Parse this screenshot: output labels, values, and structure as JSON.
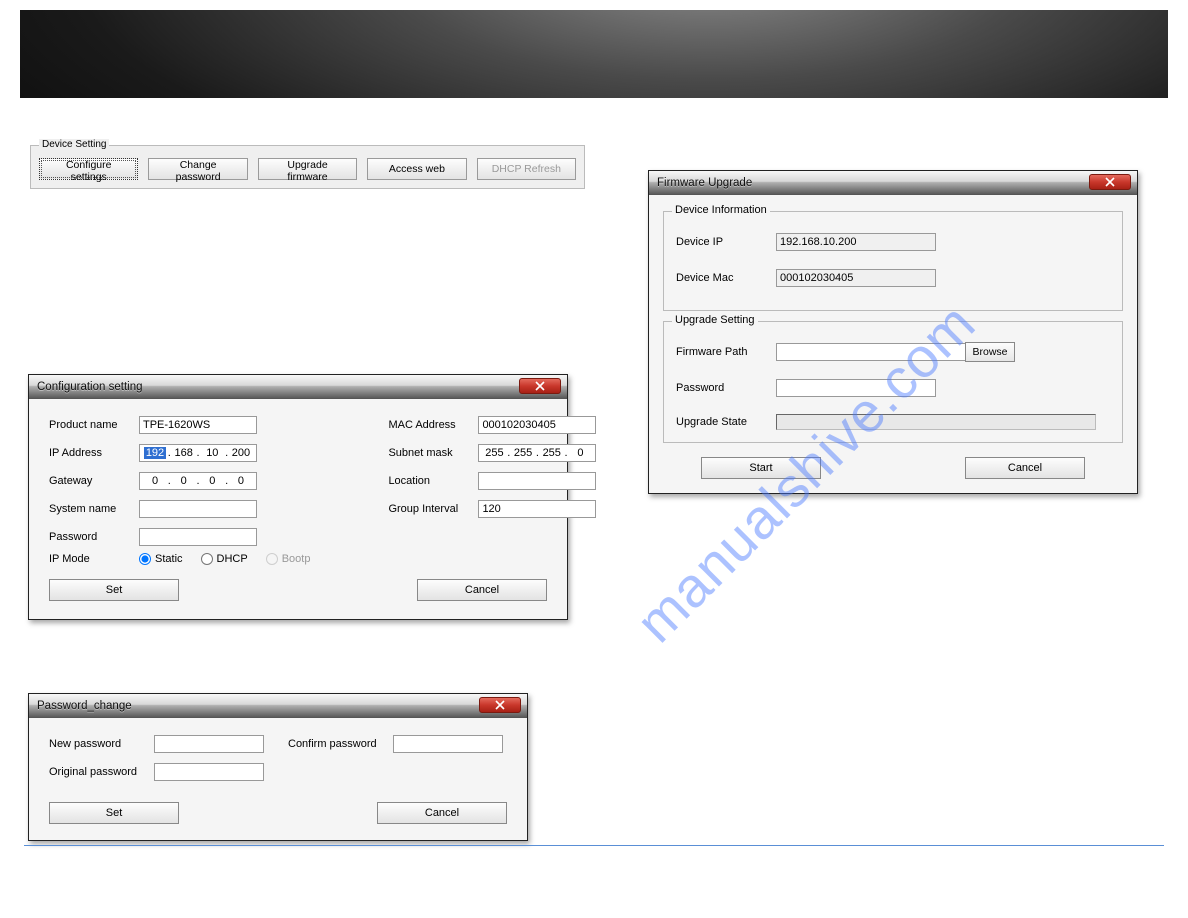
{
  "watermark": "manualshive.com",
  "device_setting": {
    "legend": "Device Setting",
    "buttons": {
      "configure": "Configure settings",
      "change_password": "Change password",
      "upgrade_firmware": "Upgrade firmware",
      "access_web": "Access web",
      "dhcp_refresh": "DHCP Refresh"
    }
  },
  "config_window": {
    "title": "Configuration setting",
    "labels": {
      "product_name": "Product name",
      "ip_address": "IP Address",
      "gateway": "Gateway",
      "system_name": "System name",
      "password": "Password",
      "ip_mode": "IP Mode",
      "mac_address": "MAC Address",
      "subnet_mask": "Subnet mask",
      "location": "Location",
      "group_interval": "Group Interval"
    },
    "values": {
      "product_name": "TPE-1620WS",
      "ip_oct": [
        "192",
        "168",
        "10",
        "200"
      ],
      "gateway_oct": [
        "0",
        "0",
        "0",
        "0"
      ],
      "system_name": "",
      "password": "",
      "mac_address": "000102030405",
      "subnet_oct": [
        "255",
        "255",
        "255",
        "0"
      ],
      "location": "",
      "group_interval": "120"
    },
    "ip_mode_options": {
      "static": "Static",
      "dhcp": "DHCP",
      "bootp": "Bootp"
    },
    "buttons": {
      "set": "Set",
      "cancel": "Cancel"
    }
  },
  "pw_window": {
    "title": "Password_change",
    "labels": {
      "new_password": "New password",
      "confirm_password": "Confirm password",
      "original_password": "Original password"
    },
    "values": {
      "new_password": "",
      "confirm_password": "",
      "original_password": ""
    },
    "buttons": {
      "set": "Set",
      "cancel": "Cancel"
    }
  },
  "fw_window": {
    "title": "Firmware Upgrade",
    "groups": {
      "device_information": "Device Information",
      "upgrade_setting": "Upgrade Setting"
    },
    "labels": {
      "device_ip": "Device IP",
      "device_mac": "Device Mac",
      "firmware_path": "Firmware Path",
      "password": "Password",
      "upgrade_state": "Upgrade State"
    },
    "values": {
      "device_ip": "192.168.10.200",
      "device_mac": "000102030405",
      "firmware_path": "",
      "password": ""
    },
    "buttons": {
      "browse": "Browse",
      "start": "Start",
      "cancel": "Cancel"
    }
  }
}
